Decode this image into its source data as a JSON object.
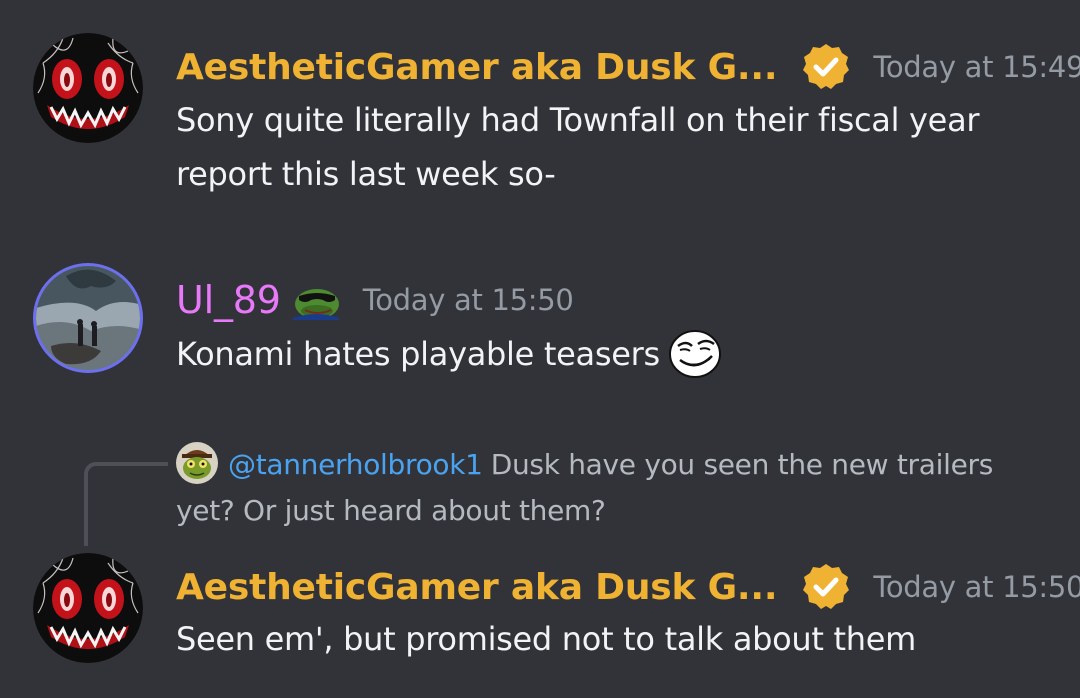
{
  "messages": [
    {
      "username": "AestheticGamer aka Dusk G...",
      "username_color": "#f0b232",
      "timestamp": "Today at 15:49",
      "line1": "Sony quite literally had Townfall on their fiscal year",
      "line2": "report this last week so-",
      "avatar_icon": "demon-face-avatar",
      "badge_icon": "verified-check-icon"
    },
    {
      "username": "Ul_89",
      "username_color": "#e879f9",
      "timestamp": "Today at 15:50",
      "text": "Konami hates playable teasers",
      "avatar_icon": "stormy-landscape-avatar",
      "role_icon": "pepe-sunglasses-icon",
      "emoji_icon": "smug-face-emoji"
    },
    {
      "reply": {
        "mention": "@tannerholbrook1",
        "text_line1": "Dusk have you seen the new trailers",
        "text_line2": "yet? Or just heard about them?",
        "avatar_icon": "frog-avatar"
      },
      "username": "AestheticGamer aka Dusk G...",
      "username_color": "#f0b232",
      "timestamp": "Today at 15:50",
      "text": "Seen em', but promised not to talk about them",
      "avatar_icon": "demon-face-avatar",
      "badge_icon": "verified-check-icon"
    }
  ],
  "colors": {
    "background": "#313338",
    "text": "#f2f3f5",
    "timestamp": "#949ba4",
    "mention": "#4ba3f0"
  }
}
